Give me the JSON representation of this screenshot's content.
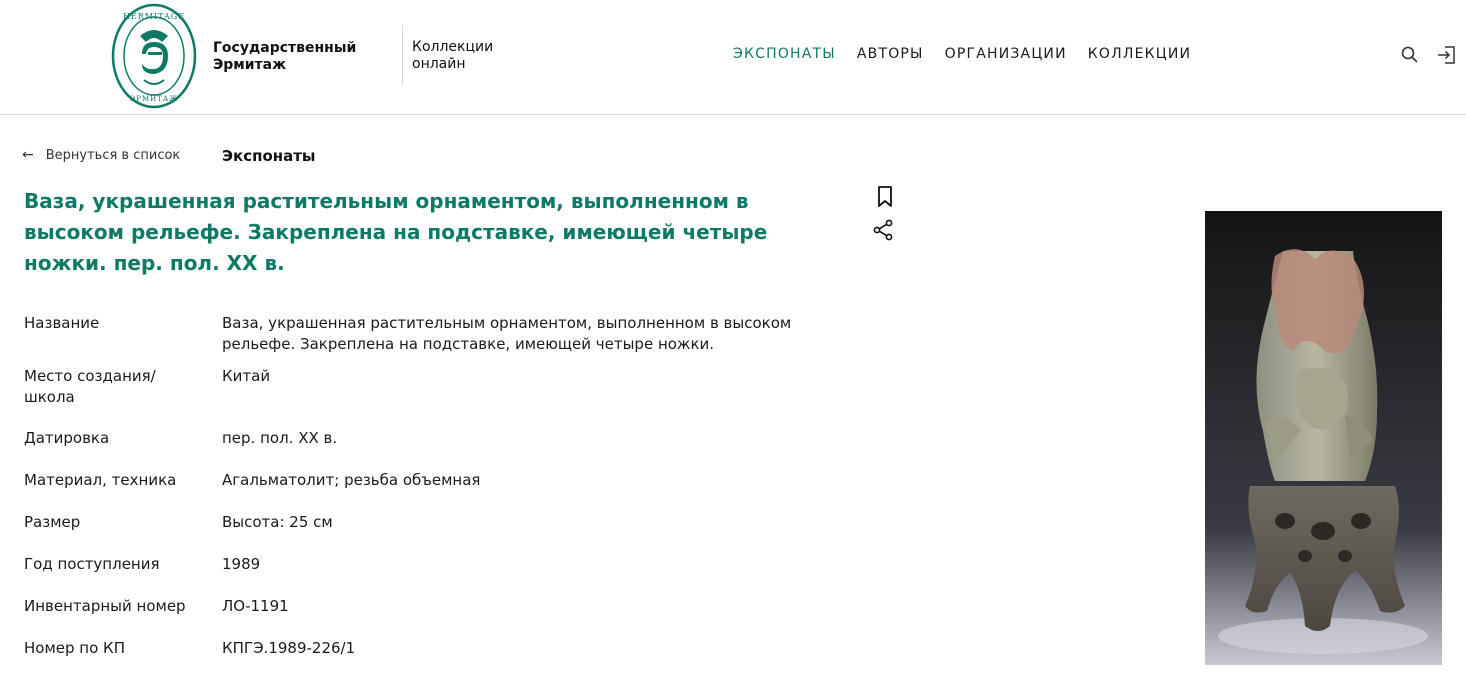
{
  "header": {
    "logo_ring_text_top": "HERMITAGE",
    "logo_ring_text_bottom": "ЭРМИТАЖ",
    "logo_line1": "Государственный",
    "logo_line2": "Эрмитаж",
    "collections_line1": "Коллекции",
    "collections_line2": "онлайн",
    "nav": [
      "ЭКСПОНАТЫ",
      "АВТОРЫ",
      "ОРГАНИЗАЦИИ",
      "КОЛЛЕКЦИИ"
    ],
    "active_nav": "ЭКСПОНАТЫ",
    "icons": [
      "search-icon",
      "login-icon"
    ]
  },
  "breadcrumb": {
    "back_label": "Вернуться в список",
    "current": "Экспонаты"
  },
  "title": "Ваза, украшенная растительным орнаментом, выполненном в высоком рельефе. Закреплена на подставке, имеющей четыре ножки. пер. пол. XX в.",
  "actions": [
    "bookmark-icon",
    "share-icon"
  ],
  "details": [
    {
      "label": "Название",
      "value": "Ваза, украшенная растительным орнаментом, выполненном в высоком рельефе. Закреплена на подставке, имеющей четыре ножки."
    },
    {
      "label": "Место создания/ школа",
      "value": "Китай"
    },
    {
      "label": "Датировка",
      "value": "пер. пол. XX в."
    },
    {
      "label": "Материал, техника",
      "value": "Агальматолит; резьба объемная"
    },
    {
      "label": "Размер",
      "value": "Высота: 25 см"
    },
    {
      "label": "Год поступления",
      "value": "1989"
    },
    {
      "label": "Инвентарный номер",
      "value": "ЛО-1191"
    },
    {
      "label": "Номер по КП",
      "value": "КПГЭ.1989-226/1"
    }
  ],
  "colors": {
    "accent": "#0e7a66",
    "text": "#1a1a1a",
    "divider": "#d9d9d9"
  }
}
